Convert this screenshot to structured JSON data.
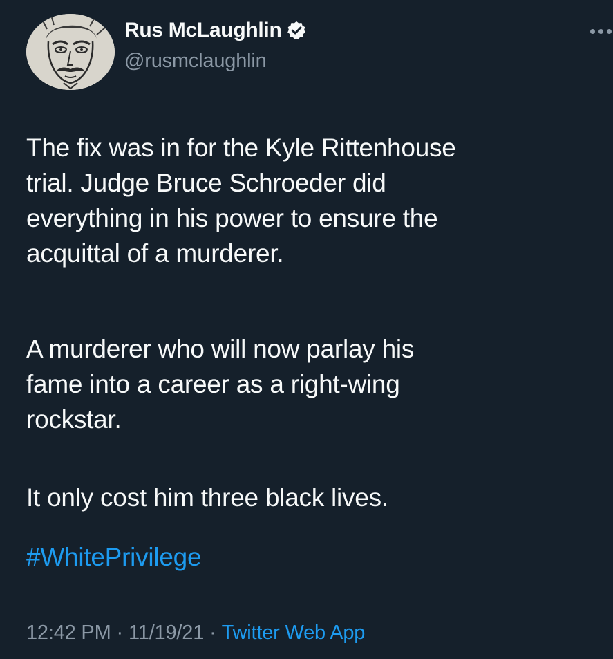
{
  "author": {
    "display_name": "Rus McLaughlin",
    "handle": "@rusmclaughlin",
    "verified": true,
    "avatar_icon": "sketched-man-portrait"
  },
  "menu_icon": "more-horizontal-icon",
  "tweet": {
    "paragraphs": [
      [
        "The fix was in for the Kyle Rittenhouse",
        "trial. Judge Bruce Schroeder did",
        "everything in his power to ensure the",
        "acquittal of a murderer."
      ],
      [
        "A murderer who will now parlay his",
        "fame into a career as a right-wing",
        "rockstar."
      ],
      [
        "It only cost him three black lives."
      ]
    ],
    "hashtag": "#WhitePrivilege"
  },
  "meta": {
    "time": "12:42 PM",
    "separator": "·",
    "date": "11/19/21",
    "source": "Twitter Web App"
  },
  "colors": {
    "background": "#15202b",
    "text": "#f7f9f9",
    "secondary": "#8b98a5",
    "accent": "#1d9bf0"
  }
}
